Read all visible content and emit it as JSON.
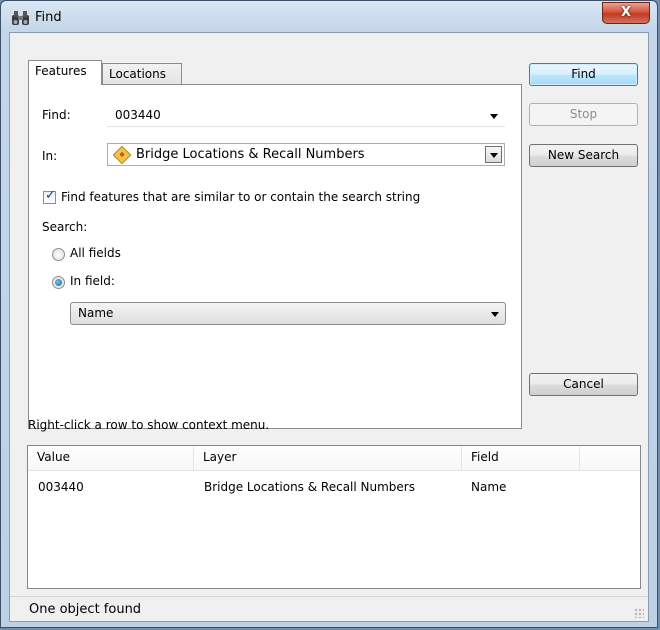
{
  "window": {
    "title": "Find",
    "close_label": "X"
  },
  "tabs": [
    {
      "label": "Features"
    },
    {
      "label": "Locations"
    }
  ],
  "form": {
    "find_label": "Find:",
    "find_value": "003440",
    "in_label": "In:",
    "in_value": "Bridge Locations & Recall Numbers",
    "similar_checkbox_label": "Find features that are similar to or contain the search string",
    "similar_checked": true,
    "search_label": "Search:",
    "all_fields_label": "All fields",
    "in_field_label": "In field:",
    "selected_search_option": "In field",
    "field_value": "Name"
  },
  "buttons": {
    "find": "Find",
    "stop": "Stop",
    "new_search": "New Search",
    "cancel": "Cancel"
  },
  "hint": "Right-click a row to show context menu.",
  "results": {
    "columns": [
      "Value",
      "Layer",
      "Field"
    ],
    "rows": [
      {
        "value": "003440",
        "layer": "Bridge Locations & Recall Numbers",
        "field": "Name"
      }
    ]
  },
  "status": "One object found"
}
